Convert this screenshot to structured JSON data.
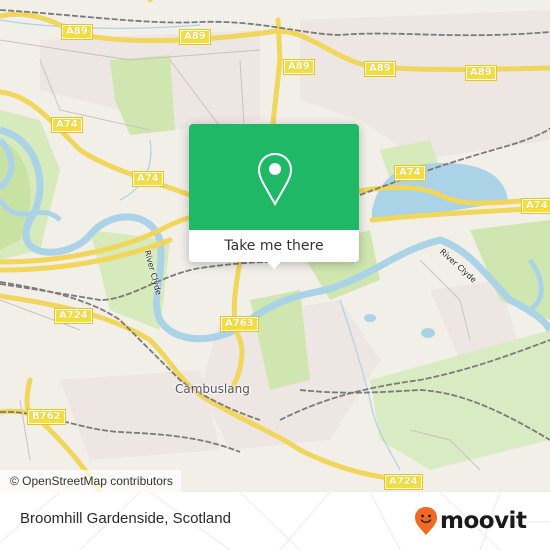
{
  "map": {
    "road_labels": [
      {
        "text": "A89",
        "id": "a89-1"
      },
      {
        "text": "A89",
        "id": "a89-2"
      },
      {
        "text": "A89",
        "id": "a89-3"
      },
      {
        "text": "A89",
        "id": "a89-4"
      },
      {
        "text": "A89",
        "id": "a89-5"
      },
      {
        "text": "A74",
        "id": "a74-1"
      },
      {
        "text": "A74",
        "id": "a74-2"
      },
      {
        "text": "A74",
        "id": "a74-3"
      },
      {
        "text": "A74",
        "id": "a74-4"
      },
      {
        "text": "A724",
        "id": "a724-1"
      },
      {
        "text": "A724",
        "id": "a724-2"
      },
      {
        "text": "A763",
        "id": "a763-1"
      },
      {
        "text": "B762",
        "id": "b762-1"
      }
    ],
    "place_labels": [
      {
        "text": "Cambuslang"
      }
    ],
    "water_labels": [
      {
        "text": "River Clyde"
      },
      {
        "text": "River Clyde"
      }
    ],
    "colors": {
      "land": "#f2efe9",
      "park": "#cfe6b0",
      "water": "#aad3e8",
      "road_major": "#f6e27a",
      "rail": "#777777"
    }
  },
  "popup": {
    "icon": "map-pin-icon",
    "button_label": "Take me there",
    "accent_color": "#1fb866"
  },
  "attribution": {
    "text": "© OpenStreetMap contributors"
  },
  "footer": {
    "location_name": "Broomhill Gardenside, Scotland",
    "logo_text": "moovit",
    "logo_icon": "moovit-pin-icon",
    "logo_color": "#f26a22"
  }
}
